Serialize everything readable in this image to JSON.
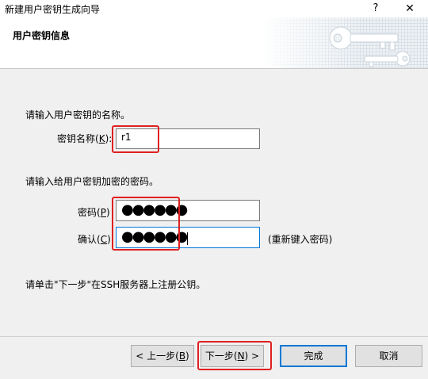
{
  "window": {
    "title": "新建用户密钥生成向导",
    "help_glyph": "?",
    "close_glyph": "✕"
  },
  "header": {
    "title": "用户密钥信息"
  },
  "form": {
    "name_prompt": "请输入用户密钥的名称。",
    "name_label_pre": "密钥名称(",
    "name_label_key": "K",
    "name_label_post": "):",
    "name_value": "r1",
    "password_prompt": "请输入给用户密钥加密的密码。",
    "password_label_pre": "密码(",
    "password_label_key": "P",
    "password_label_post": ")",
    "password_mask": "●●●●●●",
    "confirm_label_pre": "确认(",
    "confirm_label_key": "C",
    "confirm_label_post": ")",
    "confirm_mask": "●●●●●●",
    "retype_hint": "(重新键入密码)",
    "info_text": "请单击\"下一步\"在SSH服务器上注册公钥。"
  },
  "buttons": {
    "back_pre": "< 上一步(",
    "back_key": "B",
    "back_post": ")",
    "next_pre": "下一步(",
    "next_key": "N",
    "next_post": ") >",
    "finish": "完成",
    "cancel": "取消"
  },
  "colors": {
    "highlight": "#e02020",
    "focus": "#0078d7"
  }
}
